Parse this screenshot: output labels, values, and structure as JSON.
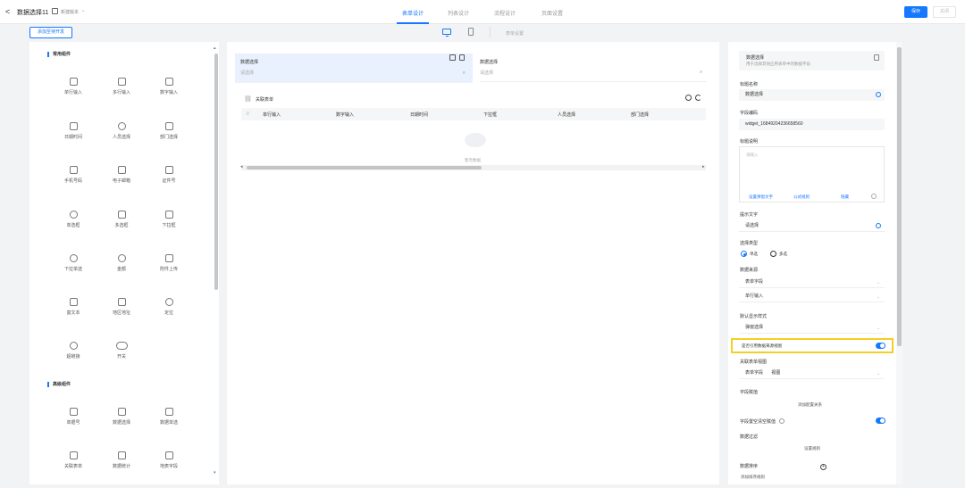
{
  "header": {
    "back_glyph": "<",
    "title": "数据选择11",
    "version_label": "新建版本",
    "tabs": [
      {
        "label": "表单设计",
        "active": true
      },
      {
        "label": "列表设计",
        "active": false
      },
      {
        "label": "流程设计",
        "active": false
      },
      {
        "label": "页面设置",
        "active": false
      }
    ],
    "save_label": "保存",
    "close_label": "关闭"
  },
  "subbar": {
    "add_dev_label": "添加至待开发",
    "table_settings_label": "表单设置"
  },
  "components": {
    "common_title": "常用组件",
    "common": [
      "单行输入",
      "多行输入",
      "数字输入",
      "日期时间",
      "人员选择",
      "部门选择",
      "手机号码",
      "电子邮箱",
      "证件号",
      "单选框",
      "多选框",
      "下拉框",
      "下拉单选",
      "金额",
      "附件上传",
      "富文本",
      "地区地址",
      "定位",
      "超链接",
      "开关"
    ],
    "advanced_title": "高级组件",
    "advanced": [
      "单据号",
      "数据选择",
      "数据单选",
      "关联表单",
      "数据统计",
      "地表字段"
    ]
  },
  "canvas": {
    "field1": {
      "label": "数据选择",
      "placeholder": "请选择"
    },
    "field2": {
      "label": "数据选择",
      "placeholder": "请选择"
    },
    "linked_table_title": "关联表单",
    "columns": [
      "单行输入",
      "数字输入",
      "日期时间",
      "下拉框",
      "人员选择",
      "部门选择"
    ],
    "empty_text": "暂无数据"
  },
  "props": {
    "header_title": "数据选择",
    "header_desc": "用于选择其他应用表单中的数据字段",
    "title_label": "标题名称",
    "title_value": "数据选择",
    "code_label": "字段编码",
    "code_value": "widget_16849204236658560",
    "desc_label": "标题说明",
    "desc_placeholder": "请输入",
    "desc_links": [
      "设置弹窗文字",
      "公式规则",
      "隐藏"
    ],
    "hint_label": "提示文字",
    "hint_value": "请选择",
    "select_type_label": "选择类型",
    "select_single": "单选",
    "select_multi": "多选",
    "source_label": "数据来源",
    "source_value1": "表单字段",
    "source_value2": "单行输入",
    "display_label": "默认显示样式",
    "display_value": "弹窗选择",
    "toggle_label": "是否引用数据来源视图",
    "view_label": "关联表单视图",
    "view_value": "表单字段",
    "view_value2": "视图",
    "assign_label": "字段赋值",
    "assign_link": "添加配置关系",
    "clear_assign_label": "字段置空清空赋值",
    "filter_label": "数据过滤",
    "filter_link": "设置规则",
    "sort_label": "数据排序",
    "sort_link": "添加排序规则"
  }
}
